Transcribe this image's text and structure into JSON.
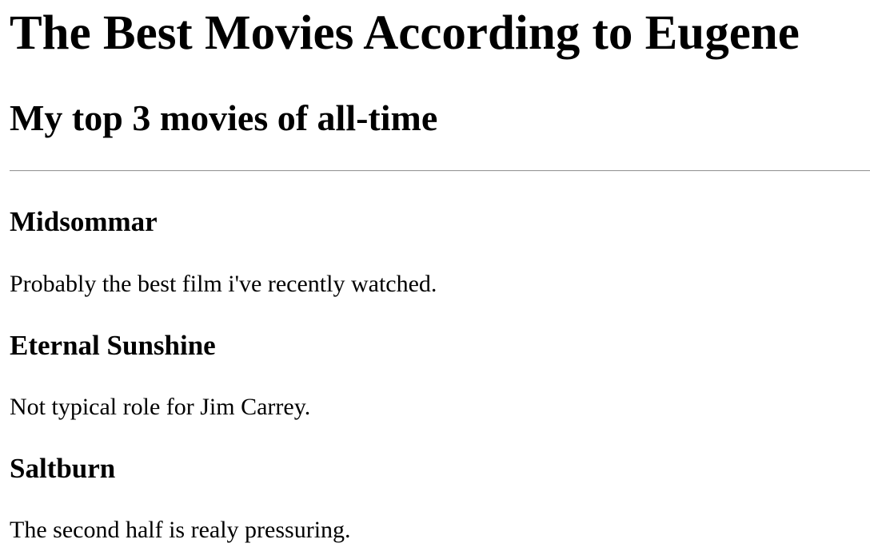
{
  "page": {
    "title": "The Best Movies According to Eugene",
    "subtitle": "My top 3 movies of all-time"
  },
  "movies": [
    {
      "title": "Midsommar",
      "description": "Probably the best film i've recently watched."
    },
    {
      "title": "Eternal Sunshine",
      "description": "Not typical role for Jim Carrey."
    },
    {
      "title": "Saltburn",
      "description": "The second half is realy pressuring."
    }
  ]
}
